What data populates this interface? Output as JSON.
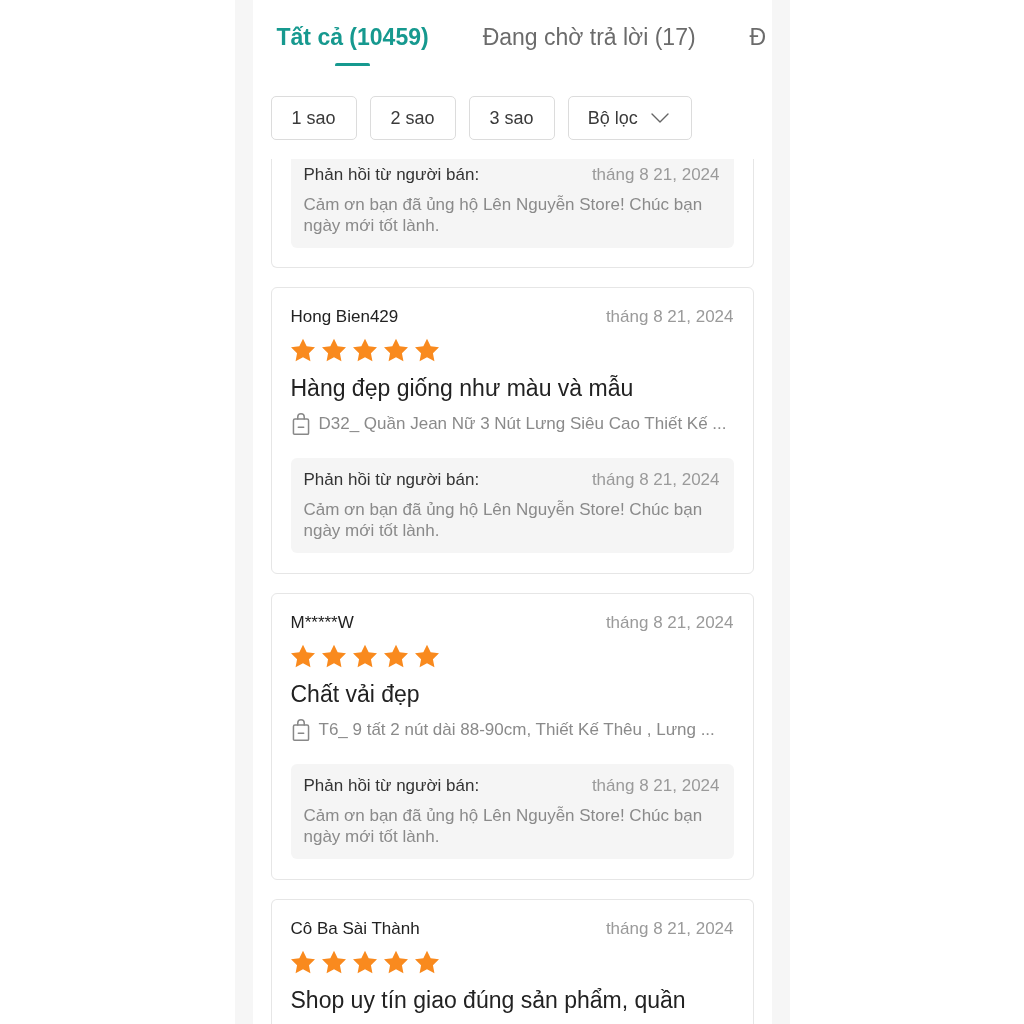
{
  "tabs": [
    {
      "label": "Tất cả (10459)",
      "selected": true
    },
    {
      "label": "Đang chờ trả lời (17)",
      "selected": false
    },
    {
      "label": "Đ",
      "selected": false
    }
  ],
  "filters": [
    {
      "label": "1 sao",
      "kind": "chip"
    },
    {
      "label": "2 sao",
      "kind": "chip"
    },
    {
      "label": "3 sao",
      "kind": "chip"
    },
    {
      "label": "Bộ lọc",
      "kind": "dropdown"
    }
  ],
  "cut_off_review": {
    "reply": {
      "label": "Phản hồi từ người bán:",
      "date": "tháng 8 21, 2024",
      "text": "Cảm ơn bạn đã ủng hộ Lên Nguyễn Store! Chúc bạn ngày mới tốt lành."
    }
  },
  "reviews": [
    {
      "user": "Hong Bien429",
      "date": "tháng 8 21, 2024",
      "stars": 5,
      "comment": "Hàng đẹp giống như màu và mẫu",
      "product": "D32_ Quần Jean Nữ 3 Nút Lưng Siêu Cao Thiết Kế ...",
      "reply": {
        "label": "Phản hồi từ người bán:",
        "date": "tháng 8 21, 2024",
        "text": "Cảm ơn bạn đã ủng hộ Lên Nguyễn Store! Chúc bạn ngày mới tốt lành."
      }
    },
    {
      "user": "M*****W",
      "date": "tháng 8 21, 2024",
      "stars": 5,
      "comment": "Chất vải đẹp",
      "product": "T6_ 9 tất 2 nút dài 88-90cm, Thiết Kế Thêu , Lưng ...",
      "reply": {
        "label": "Phản hồi từ người bán:",
        "date": "tháng 8 21, 2024",
        "text": "Cảm ơn bạn đã ủng hộ Lên Nguyễn Store! Chúc bạn ngày mới tốt lành."
      }
    },
    {
      "user": "Cô Ba Sài Thành",
      "date": "tháng 8 21, 2024",
      "stars": 5,
      "comment": "Shop uy tín giao đúng sản phẩm, quần"
    }
  ]
}
